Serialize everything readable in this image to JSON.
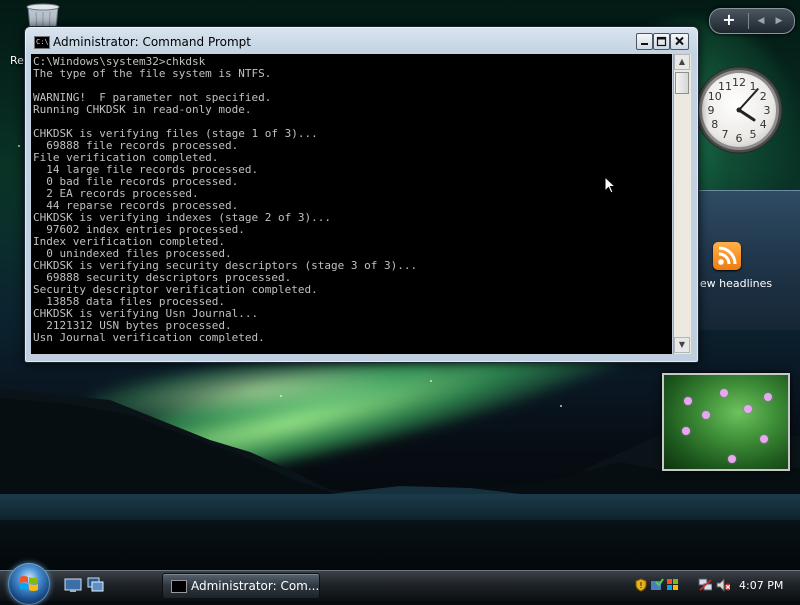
{
  "desktop": {
    "recycle_bin_label": "Re"
  },
  "sidebar": {
    "add_gadget": "+",
    "prev": "◀",
    "next": "▶",
    "clock": {
      "hour_numerals": [
        "12",
        "1",
        "2",
        "3",
        "4",
        "5",
        "6",
        "7",
        "8",
        "9",
        "10",
        "11"
      ],
      "time_shown": "4:07"
    },
    "feed_label": "ew headlines"
  },
  "cmd": {
    "title": "Administrator: Command Prompt",
    "lines": [
      "C:\\Windows\\system32>chkdsk",
      "The type of the file system is NTFS.",
      "",
      "WARNING!  F parameter not specified.",
      "Running CHKDSK in read-only mode.",
      "",
      "CHKDSK is verifying files (stage 1 of 3)...",
      "  69888 file records processed.",
      "File verification completed.",
      "  14 large file records processed.",
      "  0 bad file records processed.",
      "  2 EA records processed.",
      "  44 reparse records processed.",
      "CHKDSK is verifying indexes (stage 2 of 3)...",
      "  97602 index entries processed.",
      "Index verification completed.",
      "  0 unindexed files processed.",
      "CHKDSK is verifying security descriptors (stage 3 of 3)...",
      "  69888 security descriptors processed.",
      "Security descriptor verification completed.",
      "  13858 data files processed.",
      "CHKDSK is verifying Usn Journal...",
      "  2121312 USN bytes processed.",
      "Usn Journal verification completed."
    ]
  },
  "taskbar": {
    "task_label": "Administrator: Com...",
    "time": "4:07 PM"
  }
}
